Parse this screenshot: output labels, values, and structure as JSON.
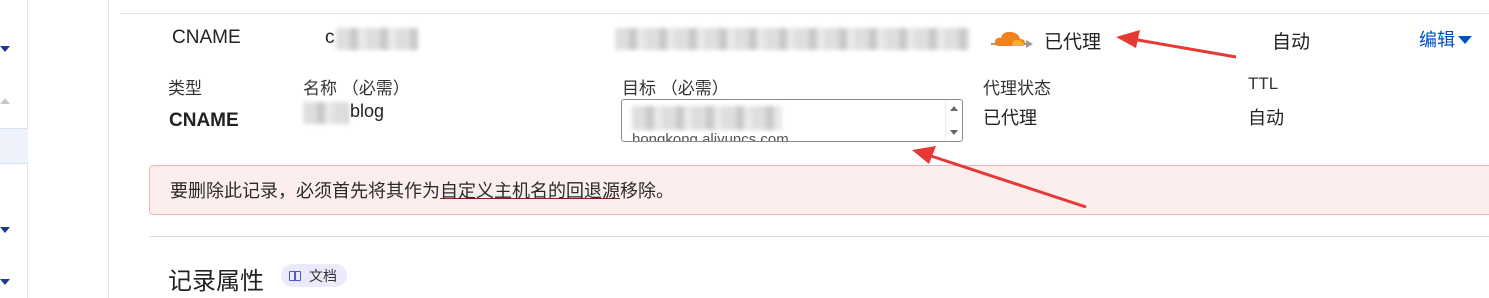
{
  "record_row": {
    "type": "CNAME",
    "name_visible_prefix": "c",
    "proxy_status": "已代理",
    "ttl": "自动",
    "edit_label": "编辑"
  },
  "edit_form": {
    "type_label": "类型",
    "type_value": "CNAME",
    "name_label": "名称 （必需）",
    "name_value_visible": "blog",
    "target_label": "目标 （必需）",
    "target_value_visible": "hongkong.aliyuncs.com",
    "proxy_label": "代理状态",
    "proxy_value": "已代理",
    "ttl_label": "TTL",
    "ttl_value": "自动"
  },
  "alert": {
    "text_before": "要删除此记录，必须首先将其作为",
    "link_text": "自定义主机名的回退源",
    "text_after": "移除。"
  },
  "section": {
    "title": "记录属性",
    "docs_label": "文档"
  },
  "colors": {
    "accent": "#0051c3",
    "cloud_orange": "#f38020",
    "alert_bg": "#fdeeee",
    "annotation_red": "#e53935"
  }
}
